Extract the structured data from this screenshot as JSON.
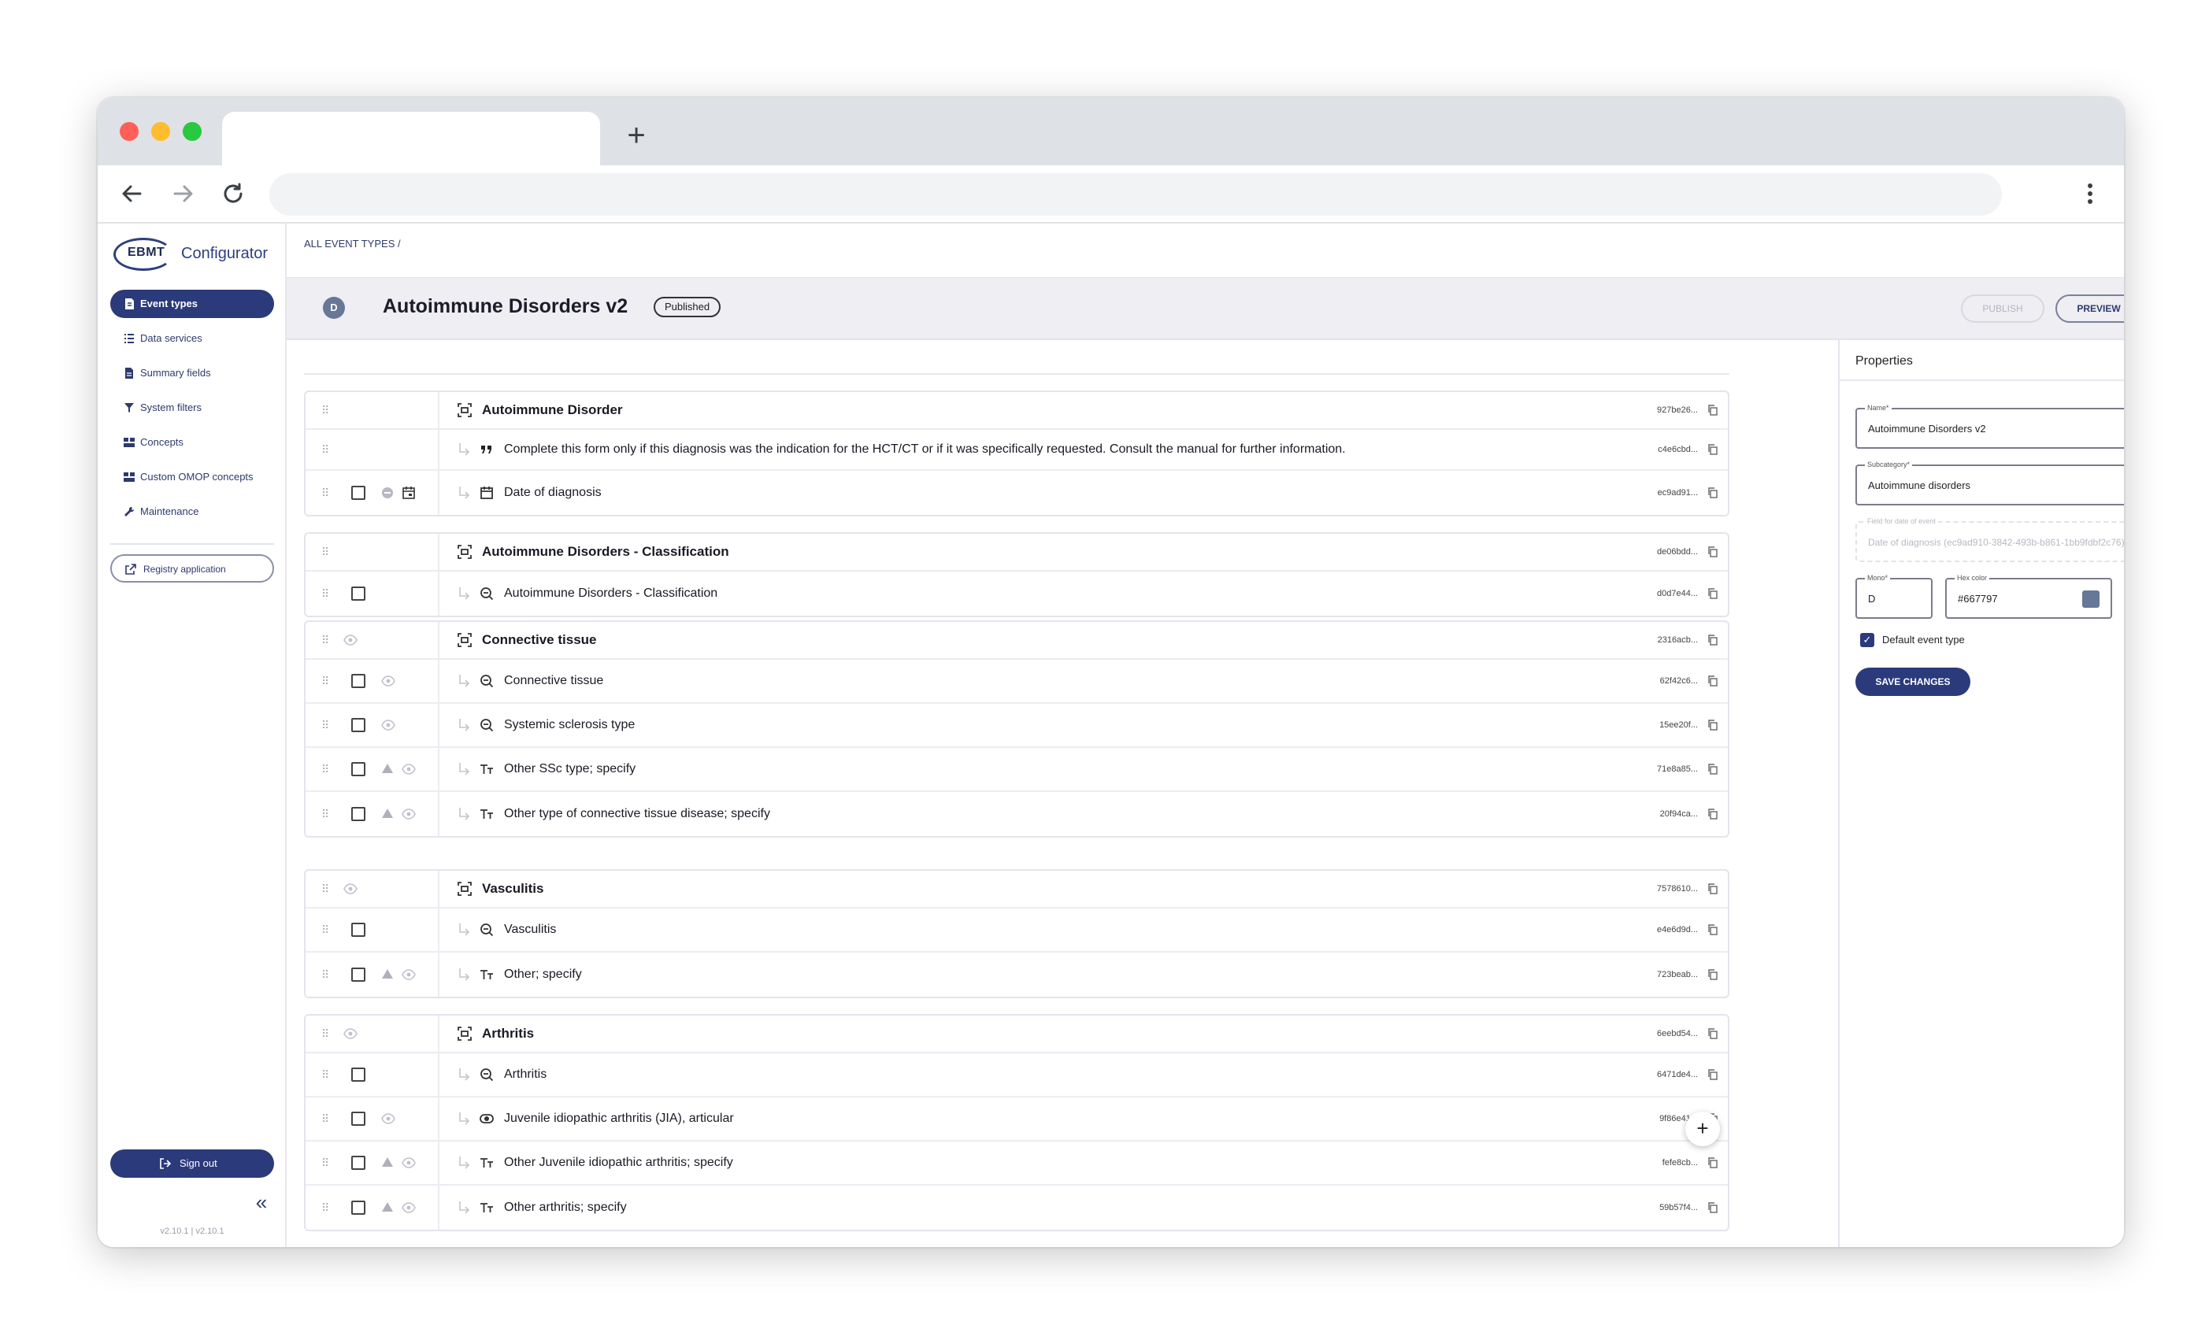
{
  "app": {
    "logo_abbr": "EBMT",
    "logo_name": "Configurator",
    "version": "v2.10.1 | v2.10.1"
  },
  "sidebar": {
    "items": [
      {
        "label": "Event types",
        "icon": "event-types-icon",
        "active": true
      },
      {
        "label": "Data services",
        "icon": "list-icon",
        "active": false
      },
      {
        "label": "Summary fields",
        "icon": "document-icon",
        "active": false
      },
      {
        "label": "System filters",
        "icon": "filter-icon",
        "active": false
      },
      {
        "label": "Concepts",
        "icon": "concepts-icon",
        "active": false
      },
      {
        "label": "Custom OMOP concepts",
        "icon": "concepts-icon",
        "active": false
      },
      {
        "label": "Maintenance",
        "icon": "wrench-icon",
        "active": false
      }
    ],
    "registry_label": "Registry application",
    "signout_label": "Sign out"
  },
  "breadcrumb": "ALL EVENT TYPES  /",
  "header": {
    "mono": "D",
    "title": "Autoimmune Disorders v2",
    "status": "Published",
    "publish_label": "PUBLISH",
    "preview_label": "PREVIEW",
    "more_label": "···"
  },
  "groups": [
    {
      "rows": [
        {
          "kind": "section",
          "label": "Autoimmune Disorder",
          "id": "927be26...",
          "icon": "section-icon"
        },
        {
          "kind": "child",
          "label": "Complete this form only if this diagnosis was the indication for the HCT/CT or if it was specifically requested. Consult the manual for further information.",
          "id": "c4e6cbd...",
          "icon": "quote-icon"
        },
        {
          "kind": "child",
          "label": "Date of diagnosis",
          "id": "ec9ad91...",
          "icon": "calendar-icon",
          "checkbox": true
        }
      ]
    },
    {
      "rows": [
        {
          "kind": "section",
          "label": "Autoimmune Disorders - Classification",
          "id": "de06bdd...",
          "icon": "section-icon"
        },
        {
          "kind": "child",
          "label": "Autoimmune Disorders - Classification",
          "id": "d0d7e44...",
          "icon": "search-icon",
          "checkbox": true
        }
      ]
    },
    {
      "rows": [
        {
          "kind": "section",
          "label": "Connective tissue",
          "id": "2316acb...",
          "icon": "section-icon",
          "eye": true
        },
        {
          "kind": "child",
          "label": "Connective tissue",
          "id": "62f42c6...",
          "icon": "search-icon",
          "checkbox": true,
          "eye": true
        },
        {
          "kind": "child",
          "label": "Systemic sclerosis type",
          "id": "15ee20f...",
          "icon": "search-icon",
          "checkbox": true,
          "eye": true
        },
        {
          "kind": "child",
          "label": "Other SSc type; specify",
          "id": "71e8a85...",
          "icon": "text-icon",
          "checkbox": true,
          "warn": true,
          "eye": true
        },
        {
          "kind": "child",
          "label": "Other type of connective tissue disease; specify",
          "id": "20f94ca...",
          "icon": "text-icon",
          "checkbox": true,
          "warn": true,
          "eye": true
        }
      ]
    },
    {
      "rows": [
        {
          "kind": "section",
          "label": "Vasculitis",
          "id": "7578610...",
          "icon": "section-icon",
          "eye": true
        },
        {
          "kind": "child",
          "label": "Vasculitis",
          "id": "e4e6d9d...",
          "icon": "search-icon",
          "checkbox": true
        },
        {
          "kind": "child",
          "label": "Other; specify",
          "id": "723beab...",
          "icon": "text-icon",
          "checkbox": true,
          "warn": true,
          "eye": true
        }
      ]
    },
    {
      "rows": [
        {
          "kind": "section",
          "label": "Arthritis",
          "id": "6eebd54...",
          "icon": "section-icon",
          "eye": true
        },
        {
          "kind": "child",
          "label": "Arthritis",
          "id": "6471de4...",
          "icon": "search-icon",
          "checkbox": true
        },
        {
          "kind": "child",
          "label": "Juvenile idiopathic arthritis (JIA), articular",
          "id": "9f86e41...",
          "icon": "toggle-icon",
          "checkbox": true,
          "eye": true
        },
        {
          "kind": "child",
          "label": "Other Juvenile idiopathic arthritis; specify",
          "id": "fefe8cb...",
          "icon": "text-icon",
          "checkbox": true,
          "warn": true,
          "eye": true
        },
        {
          "kind": "child",
          "label": "Other arthritis; specify",
          "id": "59b57f4...",
          "icon": "text-icon",
          "checkbox": true,
          "warn": true,
          "eye": true
        }
      ]
    }
  ],
  "fab_label": "+",
  "properties": {
    "title": "Properties",
    "name": {
      "label": "Name*",
      "value": "Autoimmune Disorders v2"
    },
    "subcategory": {
      "label": "Subcategory*",
      "value": "Autoimmune disorders"
    },
    "date_field": {
      "label": "Field for date of event",
      "value": "Date of diagnosis (ec9ad910-3842-493b-b861-1bb9fdbf2c76)"
    },
    "mono": {
      "label": "Mono*",
      "value": "D"
    },
    "hex": {
      "label": "Hex color",
      "value": "#667797"
    },
    "default_label": "Default event type",
    "default_checked": true,
    "save_label": "SAVE CHANGES"
  },
  "colors": {
    "brand": "#2b3a7a",
    "event_color": "#667797"
  }
}
